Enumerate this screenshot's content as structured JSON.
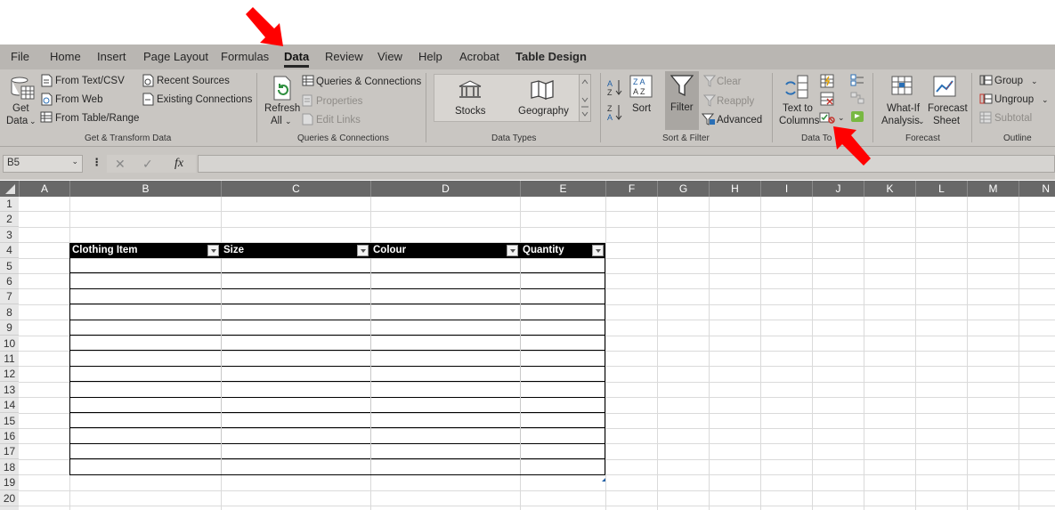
{
  "ribbon_tabs": [
    "File",
    "Home",
    "Insert",
    "Page Layout",
    "Formulas",
    "Data",
    "Review",
    "View",
    "Help",
    "Acrobat",
    "Table Design"
  ],
  "active_tab": "Data",
  "groups": {
    "get_transform": {
      "label": "Get & Transform Data",
      "get_data_1": "Get",
      "get_data_2": "Data",
      "from_text_csv": "From Text/CSV",
      "from_web": "From Web",
      "from_table_range": "From Table/Range",
      "recent_sources": "Recent Sources",
      "existing_connections": "Existing Connections"
    },
    "queries": {
      "label": "Queries & Connections",
      "refresh_1": "Refresh",
      "refresh_2": "All",
      "queries_connections": "Queries & Connections",
      "properties": "Properties",
      "edit_links": "Edit Links"
    },
    "data_types": {
      "label": "Data Types",
      "stocks": "Stocks",
      "geography": "Geography"
    },
    "sort_filter": {
      "label": "Sort & Filter",
      "sort": "Sort",
      "filter": "Filter",
      "clear": "Clear",
      "reapply": "Reapply",
      "advanced": "Advanced"
    },
    "data_tools": {
      "label": "Data To",
      "text_to_columns_1": "Text to",
      "text_to_columns_2": "Columns"
    },
    "forecast": {
      "label": "Forecast",
      "what_if_1": "What-If",
      "what_if_2": "Analysis",
      "forecast_sheet_1": "Forecast",
      "forecast_sheet_2": "Sheet"
    },
    "outline": {
      "label": "Outline",
      "group": "Group",
      "ungroup": "Ungroup",
      "subtotal": "Subtotal"
    }
  },
  "formula_bar": {
    "name_box": "B5",
    "fx": "fx",
    "content": ""
  },
  "columns": [
    "A",
    "B",
    "C",
    "D",
    "E",
    "F",
    "G",
    "H",
    "I",
    "J",
    "K",
    "L",
    "M",
    "N"
  ],
  "rows": [
    "1",
    "2",
    "3",
    "4",
    "5",
    "6",
    "7",
    "8",
    "9",
    "10",
    "11",
    "12",
    "13",
    "14",
    "15",
    "16",
    "17",
    "18",
    "19",
    "20"
  ],
  "table": {
    "headers": [
      "Clothing Item",
      "Size",
      "Colour",
      "Quantity"
    ]
  },
  "colors": {
    "annotation_arrow": "#ff0000",
    "ribbon_bg": "#c9c6c2",
    "table_header_bg": "#000000"
  }
}
